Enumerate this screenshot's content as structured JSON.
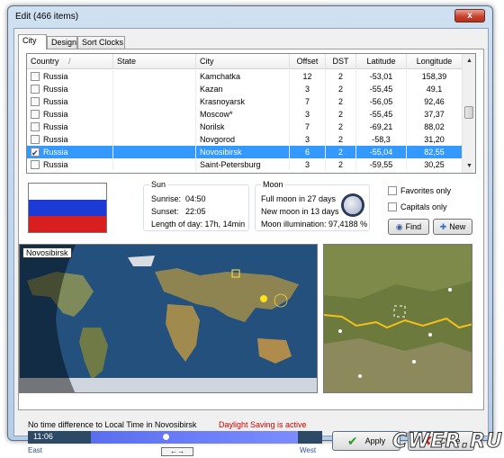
{
  "window": {
    "title": "Edit (466 items)",
    "close_glyph": "x"
  },
  "tabs": [
    {
      "label": "City"
    },
    {
      "label": "Design"
    },
    {
      "label": "Sort Clocks"
    }
  ],
  "grid": {
    "columns": [
      "Country",
      "State",
      "City",
      "Offset",
      "DST",
      "Latitude",
      "Longitude"
    ],
    "sort_indicator": "/",
    "rows": [
      {
        "checked": false,
        "selected": false,
        "country": "Russia",
        "state": "",
        "city": "Kamchatka",
        "offset": "12",
        "dst": "2",
        "latitude": "-53,01",
        "longitude": "158,39"
      },
      {
        "checked": false,
        "selected": false,
        "country": "Russia",
        "state": "",
        "city": "Kazan",
        "offset": "3",
        "dst": "2",
        "latitude": "-55,45",
        "longitude": "49,1"
      },
      {
        "checked": false,
        "selected": false,
        "country": "Russia",
        "state": "",
        "city": "Krasnoyarsk",
        "offset": "7",
        "dst": "2",
        "latitude": "-56,05",
        "longitude": "92,46"
      },
      {
        "checked": false,
        "selected": false,
        "country": "Russia",
        "state": "",
        "city": "Moscow*",
        "offset": "3",
        "dst": "2",
        "latitude": "-55,45",
        "longitude": "37,37"
      },
      {
        "checked": false,
        "selected": false,
        "country": "Russia",
        "state": "",
        "city": "Norilsk",
        "offset": "7",
        "dst": "2",
        "latitude": "-69,21",
        "longitude": "88,02"
      },
      {
        "checked": false,
        "selected": false,
        "country": "Russia",
        "state": "",
        "city": "Novgorod",
        "offset": "3",
        "dst": "2",
        "latitude": "-58,3",
        "longitude": "31,20"
      },
      {
        "checked": true,
        "selected": true,
        "country": "Russia",
        "state": "",
        "city": "Novosibirsk",
        "offset": "6",
        "dst": "2",
        "latitude": "-55,04",
        "longitude": "82,55"
      },
      {
        "checked": false,
        "selected": false,
        "country": "Russia",
        "state": "",
        "city": "Saint-Petersburg",
        "offset": "3",
        "dst": "2",
        "latitude": "-59,55",
        "longitude": "30,25"
      }
    ]
  },
  "flag_colors": [
    "#ffffff",
    "#1c3bd6",
    "#d81e1e"
  ],
  "sun": {
    "legend": "Sun",
    "sunrise_label": "Sunrise:",
    "sunrise": "04:50",
    "sunset_label": "Sunset:",
    "sunset": "22:05",
    "day_length": "Length of day: 17h, 14min"
  },
  "moon": {
    "legend": "Moon",
    "full_moon": "Full moon in 27 days",
    "new_moon": "New moon in 13 days",
    "illumination": "Moon illumination: 97,4188 %"
  },
  "filters": {
    "favorites": "Favorites only",
    "capitals": "Capitals only"
  },
  "buttons": {
    "find": "Find",
    "new": "New",
    "apply": "Apply",
    "close": "Close"
  },
  "map": {
    "label": "Novosibirsk"
  },
  "bottom": {
    "time_note": "No time difference to Local Time in Novosibirsk",
    "dst_status": "Daylight Saving is active",
    "time": "11:06",
    "east": "East",
    "west": "West",
    "swap_glyph": "←→"
  },
  "watermark": "CWER.RU",
  "colors": {
    "selection": "#3399ff",
    "dst_text": "#d00000",
    "night": "#2c4a66",
    "day": "#6a7cf8"
  }
}
